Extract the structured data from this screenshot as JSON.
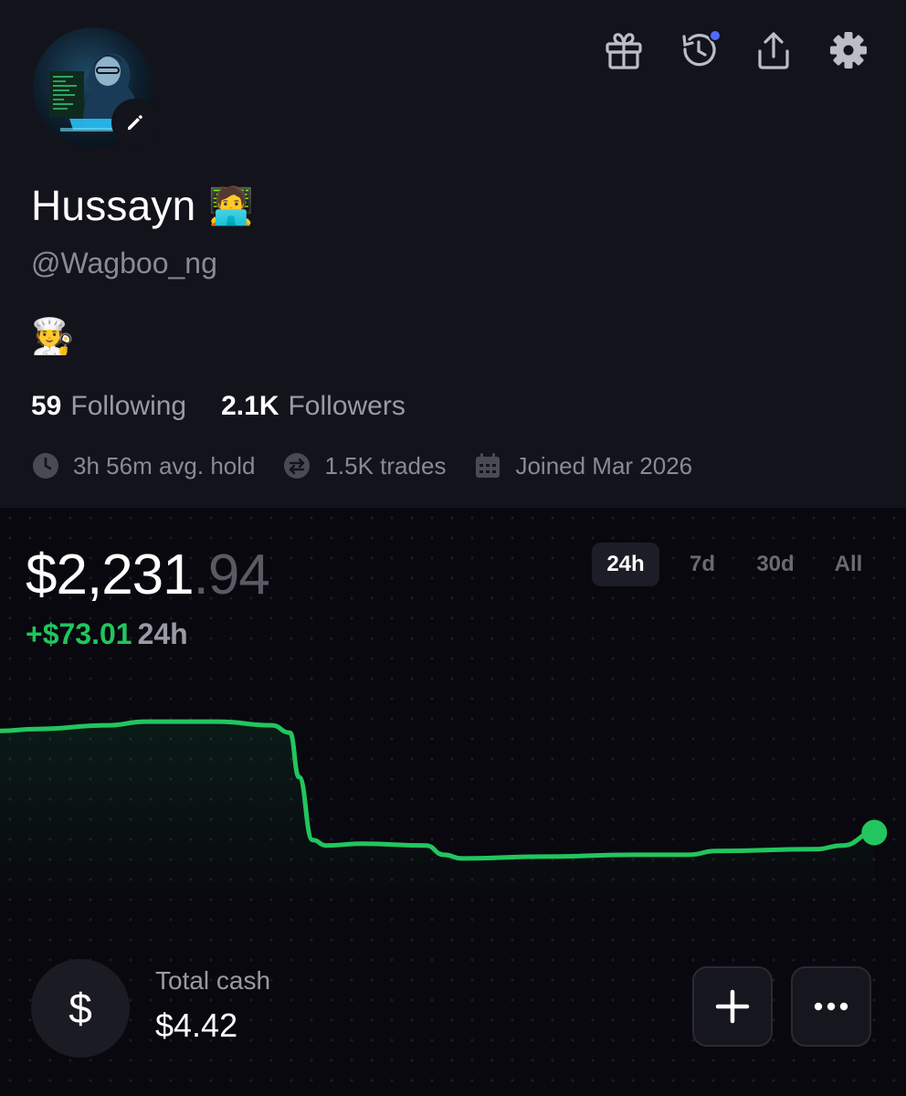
{
  "profile": {
    "display_name": "Hussayn",
    "name_emoji": "🧑‍💻",
    "handle": "@Wagboo_ng",
    "bio": "🧑‍🍳",
    "following_count": "59",
    "following_label": "Following",
    "followers_count": "2.1K",
    "followers_label": "Followers",
    "stats": {
      "avg_hold": "3h 56m avg. hold",
      "trades": "1.5K trades",
      "joined": "Joined Mar 2026"
    }
  },
  "header_icons": [
    "gift-icon",
    "history-icon",
    "share-icon",
    "settings-icon"
  ],
  "portfolio": {
    "balance_main": "$2,231",
    "balance_cents": ".94",
    "change_amount": "+$73.01",
    "change_period": "24h",
    "tabs": [
      "24h",
      "7d",
      "30d",
      "All"
    ],
    "active_tab": "24h"
  },
  "cash": {
    "icon_glyph": "$",
    "label": "Total cash",
    "value": "$4.42"
  },
  "colors": {
    "profile_bg": "#13131b",
    "page_bg": "#08080e",
    "positive": "#22c55e",
    "accent_dot": "#4f6bff"
  },
  "chart_data": {
    "type": "line",
    "title": "",
    "xlabel": "",
    "ylabel": "",
    "timeframe": "24h",
    "x": [
      0,
      0.04,
      0.12,
      0.16,
      0.24,
      0.3,
      0.32,
      0.33,
      0.345,
      0.36,
      0.4,
      0.47,
      0.49,
      0.51,
      0.6,
      0.7,
      0.76,
      0.79,
      0.9,
      0.93,
      0.965
    ],
    "values": [
      2255,
      2256,
      2258,
      2260,
      2260,
      2258,
      2254,
      2230,
      2196,
      2193,
      2194,
      2193,
      2188,
      2186,
      2187,
      2188,
      2188,
      2190,
      2191,
      2193,
      2200
    ],
    "grid": false,
    "legend": "none"
  }
}
